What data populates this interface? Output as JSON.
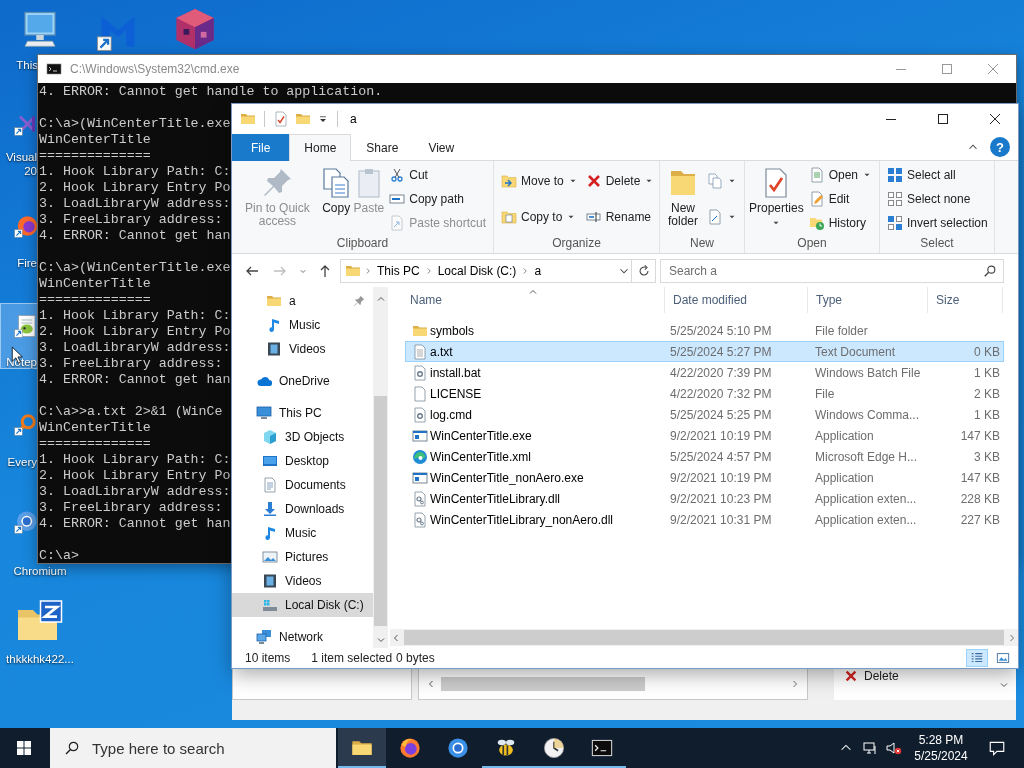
{
  "desktop": {
    "icons": [
      {
        "label_lines": [
          "This"
        ],
        "selected": false
      },
      {
        "selected": false
      },
      {
        "selected": false
      },
      {
        "label_lines": [
          "Visual",
          "20"
        ],
        "selected": false
      },
      {
        "label_lines": [
          "Fire"
        ],
        "selected": false
      },
      {
        "label_lines": [
          "Notep"
        ],
        "selected": true
      },
      {
        "label_lines": [
          "Every"
        ],
        "selected": false
      },
      {
        "label_lines": [
          "Chromium"
        ],
        "selected": false
      },
      {
        "label_lines": [
          "thkkkhk422..."
        ],
        "selected": false
      }
    ]
  },
  "cmd": {
    "title": "C:\\Windows\\System32\\cmd.exe",
    "blocks": [
      [
        "4. ERROR: Cannot get handle to application."
      ],
      [
        "C:\\a>(WinCenterTitle.exe",
        "WinCenterTitle",
        "==============",
        "1. Hook Library Path: C:",
        "2. Hook Library Entry Po",
        "3. LoadLibraryW address:",
        "3. FreeLibrary address:",
        "4. ERROR: Cannot get han"
      ],
      [
        "C:\\a>(WinCenterTitle.exe",
        "WinCenterTitle",
        "==============",
        "1. Hook Library Path: C:",
        "2. Hook Library Entry Po",
        "3. LoadLibraryW address:",
        "3. FreeLibrary address:",
        "4. ERROR: Cannot get han"
      ],
      [
        "C:\\a>>a.txt 2>&1 (WinCe",
        "WinCenterTitle",
        "==============",
        "1. Hook Library Path: C:",
        "2. Hook Library Entry Po",
        "3. LoadLibraryW address:",
        "3. FreeLibrary address:",
        "4. ERROR: Cannot get han"
      ],
      [
        "C:\\a>"
      ]
    ]
  },
  "explorer": {
    "title": "a",
    "tabs": [
      {
        "label": "File",
        "kind": "file",
        "selected": false
      },
      {
        "label": "Home",
        "kind": "tab",
        "selected": true
      },
      {
        "label": "Share",
        "kind": "tab",
        "selected": false
      },
      {
        "label": "View",
        "kind": "tab",
        "selected": false
      }
    ],
    "help_glyph": "?",
    "ribbon": [
      {
        "label": "Clipboard",
        "items": [
          {
            "kind": "large",
            "label": "Pin to Quick access",
            "disabled": true,
            "dropdown": false
          },
          {
            "kind": "large",
            "label": "Copy",
            "disabled": false,
            "dropdown": false
          },
          {
            "kind": "large",
            "label": "Paste",
            "disabled": true,
            "dropdown": false
          },
          {
            "kind": "stack",
            "items": [
              {
                "label": "Cut",
                "disabled": false,
                "dropdown": false
              },
              {
                "label": "Copy path",
                "disabled": false,
                "dropdown": false
              },
              {
                "label": "Paste shortcut",
                "disabled": true,
                "dropdown": false
              }
            ]
          }
        ]
      },
      {
        "label": "Organize",
        "items": [
          {
            "kind": "stack",
            "items": [
              {
                "label": "Move to",
                "disabled": false,
                "dropdown": true
              },
              {
                "label": "Copy to",
                "disabled": false,
                "dropdown": true
              }
            ]
          },
          {
            "kind": "stack",
            "items": [
              {
                "label": "Delete",
                "disabled": false,
                "dropdown": true
              },
              {
                "label": "Rename",
                "disabled": false,
                "dropdown": false
              }
            ]
          }
        ]
      },
      {
        "label": "New",
        "items": [
          {
            "kind": "large",
            "label": "New folder",
            "disabled": false,
            "dropdown": false
          },
          {
            "kind": "stack",
            "items": [
              {
                "disabled": false,
                "dropdown": true
              },
              {
                "disabled": false,
                "dropdown": true
              }
            ]
          }
        ]
      },
      {
        "label": "Open",
        "items": [
          {
            "kind": "large",
            "label": "Properties",
            "disabled": false,
            "dropdown": true
          },
          {
            "kind": "stack",
            "items": [
              {
                "label": "Open",
                "disabled": false,
                "dropdown": true
              },
              {
                "label": "Edit",
                "disabled": false,
                "dropdown": false
              },
              {
                "label": "History",
                "disabled": false,
                "dropdown": false
              }
            ]
          }
        ]
      },
      {
        "label": "Select",
        "items": [
          {
            "kind": "stack",
            "items": [
              {
                "label": "Select all",
                "disabled": false,
                "dropdown": false
              },
              {
                "label": "Select none",
                "disabled": false,
                "dropdown": false
              },
              {
                "label": "Invert selection",
                "disabled": false,
                "dropdown": false
              }
            ]
          }
        ]
      }
    ],
    "nav_buttons": [
      {
        "kind": "back",
        "disabled": false
      },
      {
        "kind": "forward",
        "disabled": true
      },
      {
        "kind": "recent",
        "disabled": false
      },
      {
        "kind": "up",
        "disabled": false
      }
    ],
    "address": {
      "crumbs": [
        "This PC",
        "Local Disk (C:)",
        "a"
      ]
    },
    "search": {
      "placeholder": "Search a"
    },
    "nav_pane": {
      "quick_access": [
        {
          "label": "a",
          "kind": "folder",
          "pinned": true,
          "selected": false
        },
        {
          "label": "Music",
          "kind": "music",
          "pinned": false,
          "selected": false
        },
        {
          "label": "Videos",
          "kind": "videos",
          "pinned": false,
          "selected": false
        }
      ],
      "items": [
        {
          "label": "OneDrive",
          "kind": "onedrive",
          "selected": false
        },
        {
          "label": "This PC",
          "kind": "pc",
          "selected": false,
          "children": [
            {
              "label": "3D Objects",
              "kind": "objects3d",
              "selected": false
            },
            {
              "label": "Desktop",
              "kind": "desktop",
              "selected": false
            },
            {
              "label": "Documents",
              "kind": "documents",
              "selected": false
            },
            {
              "label": "Downloads",
              "kind": "downloads",
              "selected": false
            },
            {
              "label": "Music",
              "kind": "music",
              "selected": false
            },
            {
              "label": "Pictures",
              "kind": "pictures",
              "selected": false
            },
            {
              "label": "Videos",
              "kind": "videos",
              "selected": false
            },
            {
              "label": "Local Disk (C:)",
              "kind": "disk",
              "selected": true
            }
          ]
        },
        {
          "label": "Network",
          "kind": "network",
          "selected": false
        }
      ]
    },
    "columns": [
      "Name",
      "Date modified",
      "Type",
      "Size"
    ],
    "rows": [
      {
        "name": "symbols",
        "kind": "folder",
        "date": "5/25/2024 5:10 PM",
        "type": "File folder",
        "selected": false
      },
      {
        "name": "a.txt",
        "kind": "text",
        "date": "5/25/2024 5:27 PM",
        "type": "Text Document",
        "size": "0 KB",
        "selected": true
      },
      {
        "name": "install.bat",
        "kind": "script",
        "date": "4/22/2020 7:39 PM",
        "type": "Windows Batch File",
        "size": "1 KB",
        "selected": false
      },
      {
        "name": "LICENSE",
        "kind": "file",
        "date": "4/22/2020 7:32 PM",
        "type": "File",
        "size": "2 KB",
        "selected": false
      },
      {
        "name": "log.cmd",
        "kind": "script",
        "date": "5/25/2024 5:25 PM",
        "type": "Windows Comma...",
        "size": "1 KB",
        "selected": false
      },
      {
        "name": "WinCenterTitle.exe",
        "kind": "exe",
        "date": "9/2/2021 10:19 PM",
        "type": "Application",
        "size": "147 KB",
        "selected": false
      },
      {
        "name": "WinCenterTitle.xml",
        "kind": "web",
        "date": "5/25/2024 4:57 PM",
        "type": "Microsoft Edge H...",
        "size": "3 KB",
        "selected": false
      },
      {
        "name": "WinCenterTitle_nonAero.exe",
        "kind": "exe",
        "date": "9/2/2021 10:19 PM",
        "type": "Application",
        "size": "147 KB",
        "selected": false
      },
      {
        "name": "WinCenterTitleLibrary.dll",
        "kind": "dll",
        "date": "9/2/2021 10:23 PM",
        "type": "Application exten...",
        "size": "228 KB",
        "selected": false
      },
      {
        "name": "WinCenterTitleLibrary_nonAero.dll",
        "kind": "dll",
        "date": "9/2/2021 10:31 PM",
        "type": "Application exten...",
        "size": "227 KB",
        "selected": false
      }
    ],
    "status": {
      "item_count": "10 items",
      "selection": "1 item selected",
      "selection_size": "0 bytes"
    },
    "views": [
      {
        "kind": "details",
        "selected": true
      },
      {
        "kind": "large_icons",
        "selected": false
      }
    ]
  },
  "background_window": {
    "action": "Delete"
  },
  "taskbar": {
    "search": {
      "placeholder": "Type here to search"
    },
    "apps": [
      {
        "active": true,
        "running": true
      },
      {
        "active": false,
        "running": false
      },
      {
        "active": false,
        "running": false
      },
      {
        "active": false,
        "running": true
      },
      {
        "active": false,
        "running": true
      },
      {
        "active": false,
        "running": true
      }
    ],
    "time": "5:28 PM",
    "date": "5/25/2024"
  }
}
